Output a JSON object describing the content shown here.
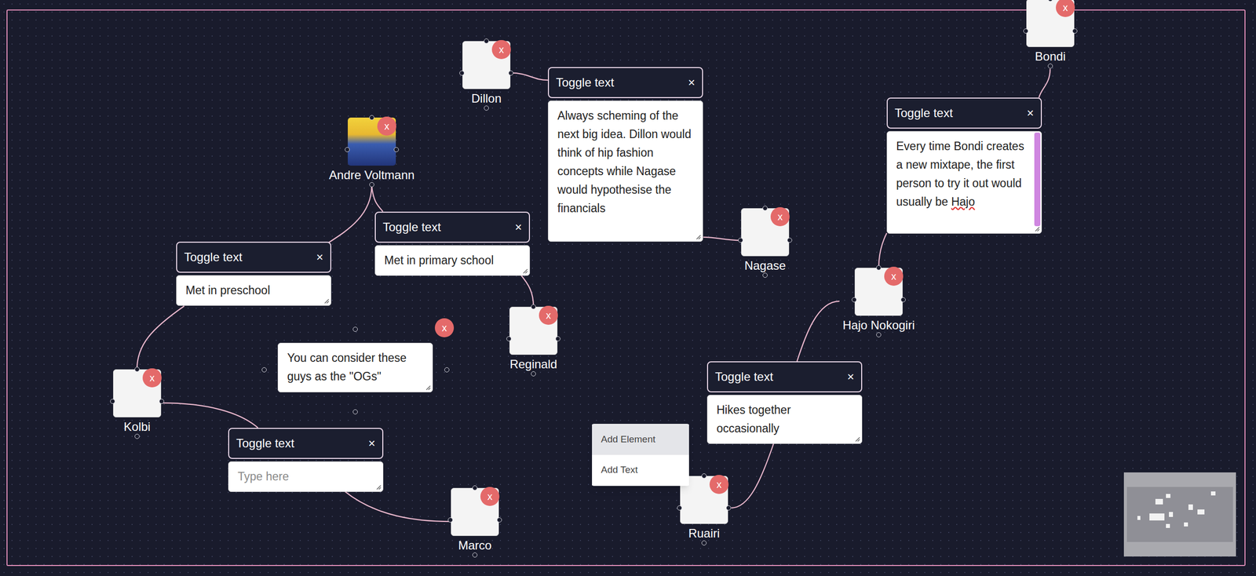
{
  "nodes": [
    {
      "name": "Dillon",
      "kind": "sketch",
      "close": "x"
    },
    {
      "name": "Andre Voltmann",
      "kind": "photo",
      "close": "x"
    },
    {
      "name": "Nagase",
      "kind": "sketch",
      "close": "x"
    },
    {
      "name": "Bondi",
      "kind": "sketch",
      "close": "x"
    },
    {
      "name": "Hajo Nokogiri",
      "kind": "sketch",
      "close": "x"
    },
    {
      "name": "Reginald",
      "kind": "sketch",
      "close": "x"
    },
    {
      "name": "Kolbi",
      "kind": "sketch",
      "close": "x"
    },
    {
      "name": "Marco",
      "kind": "sketch",
      "close": "x"
    },
    {
      "name": "Ruairi",
      "kind": "sketch",
      "close": "x"
    }
  ],
  "edge_labels": [
    {
      "header": "Toggle text",
      "close": "×",
      "value": "Always scheming of the next big idea. Dillon would think of hip fashion concepts while Nagase would hypothesise the financials",
      "placeholder": "",
      "flagged_word": "",
      "scrollbar": false
    },
    {
      "header": "Toggle text",
      "close": "×",
      "value": "Met in preschool",
      "placeholder": "",
      "flagged_word": "",
      "scrollbar": false
    },
    {
      "header": "Toggle text",
      "close": "×",
      "value": "Met in primary school",
      "placeholder": "",
      "flagged_word": "",
      "scrollbar": false
    },
    {
      "header": "Toggle text",
      "close": "×",
      "value": "",
      "placeholder": "Type here",
      "flagged_word": "",
      "scrollbar": false
    },
    {
      "header": "Toggle text",
      "close": "×",
      "value": "Every time Bondi creates a new mixtape, the first person to try it out would usually be Hajo",
      "placeholder": "",
      "flagged_word": "Hajo",
      "scrollbar": true
    },
    {
      "header": "Toggle text",
      "close": "×",
      "value": "Hikes together occasionally",
      "placeholder": "",
      "flagged_word": "",
      "scrollbar": false
    }
  ],
  "text_node": {
    "text": "You can consider these guys as the \"OGs\"",
    "close": "x"
  },
  "context_menu": {
    "items": [
      {
        "label": "Add Element",
        "selected": true
      },
      {
        "label": "Add Text",
        "selected": false
      }
    ]
  }
}
